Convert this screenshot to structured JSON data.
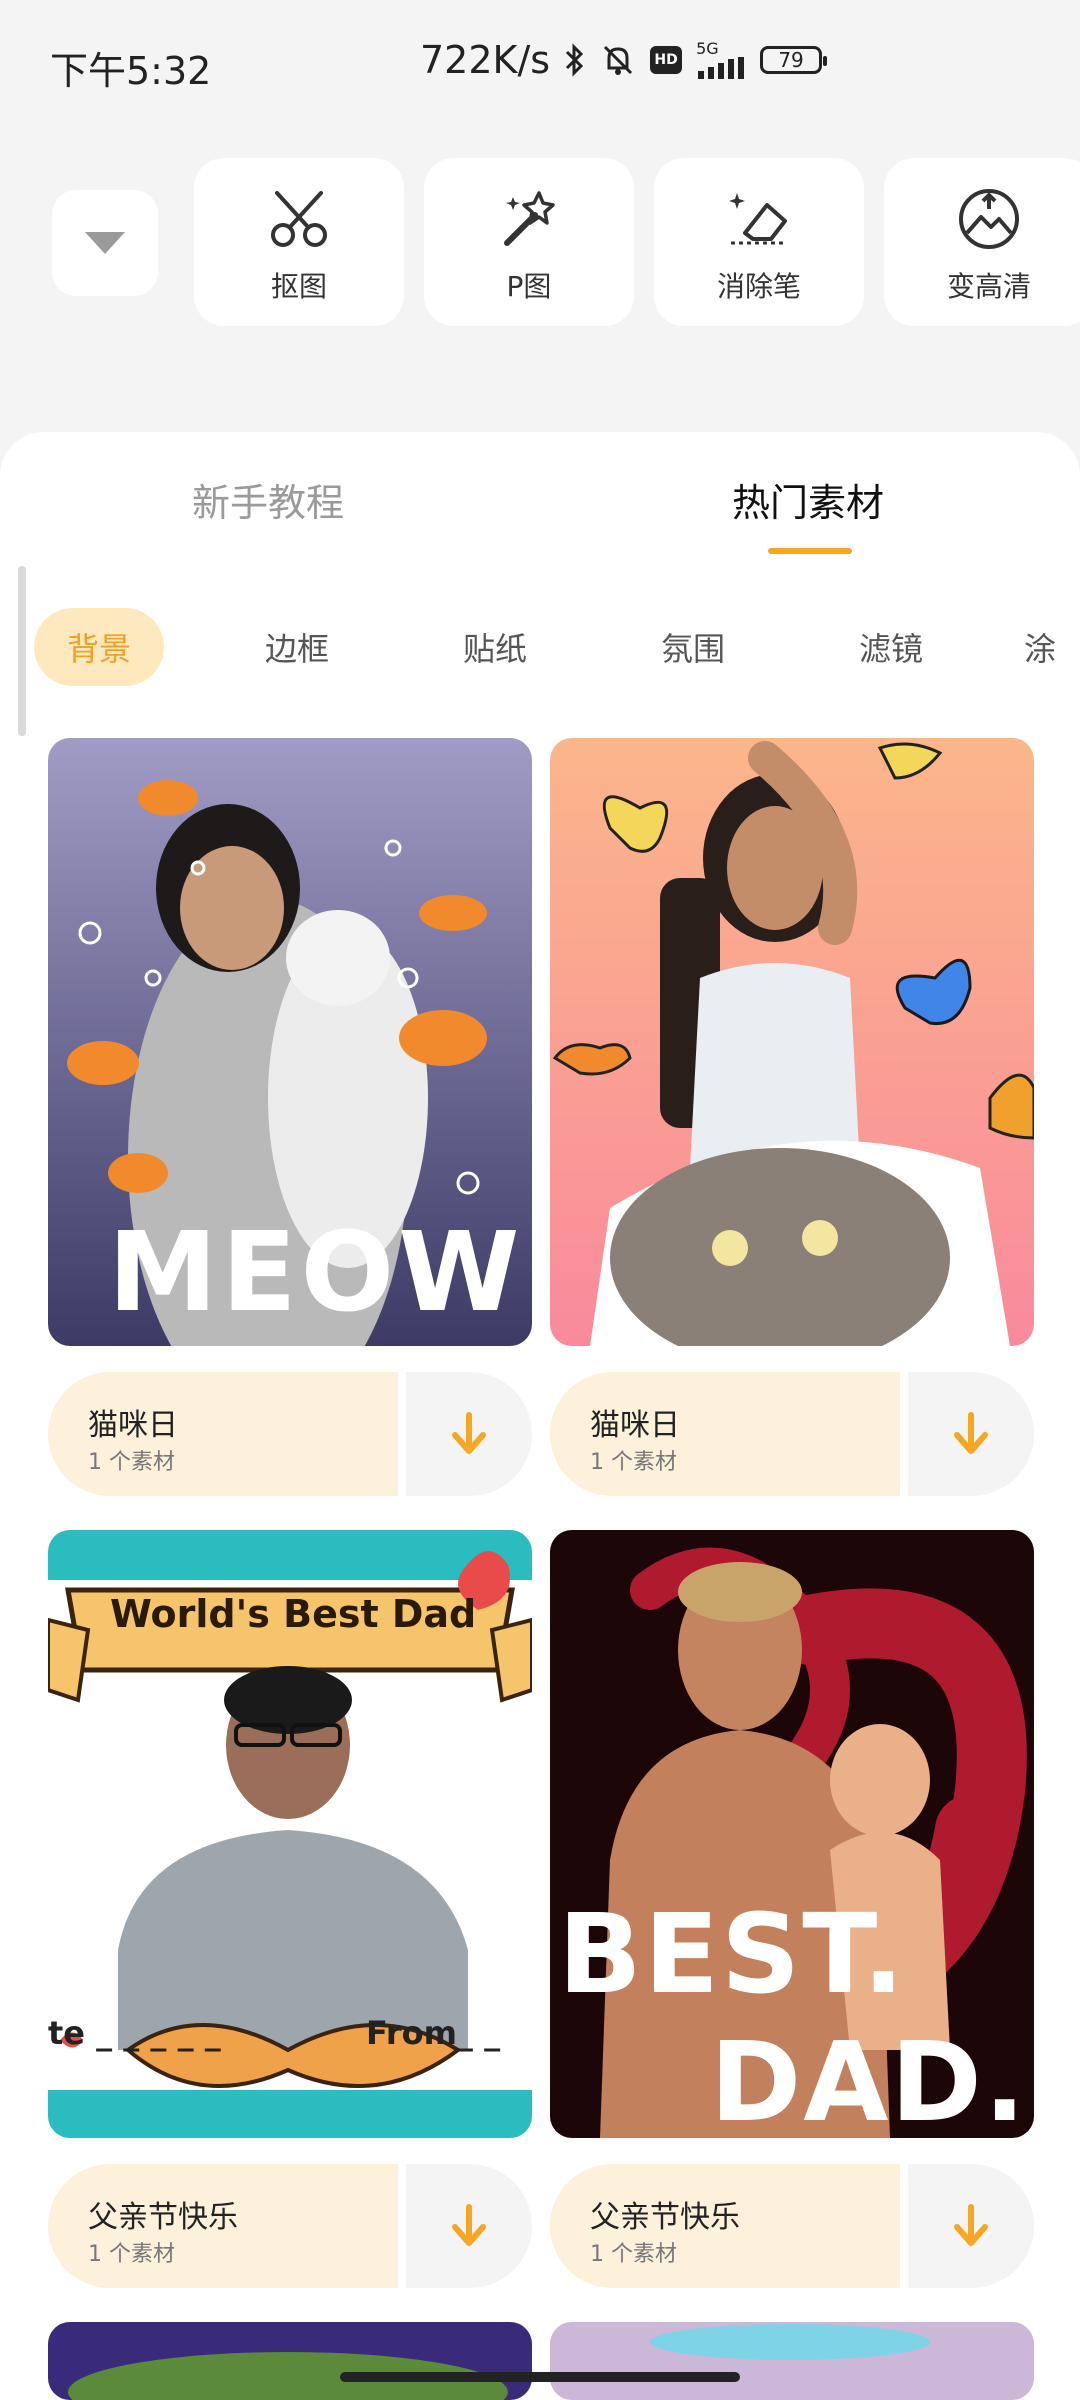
{
  "status_bar": {
    "time": "下午5:32",
    "speed": "722K/s",
    "network": "5G",
    "hd": "HD",
    "battery": "79"
  },
  "tools": [
    {
      "label": "抠图",
      "icon": "cutout-scissors-icon"
    },
    {
      "label": "P图",
      "icon": "magic-wand-icon"
    },
    {
      "label": "消除笔",
      "icon": "eraser-icon"
    },
    {
      "label": "变高清",
      "icon": "hd-enhance-icon"
    }
  ],
  "top_tabs": [
    {
      "label": "新手教程",
      "active": false
    },
    {
      "label": "热门素材",
      "active": true
    }
  ],
  "categories": [
    {
      "label": "背景",
      "active": true
    },
    {
      "label": "边框",
      "active": false
    },
    {
      "label": "贴纸",
      "active": false
    },
    {
      "label": "氛围",
      "active": false
    },
    {
      "label": "滤镜",
      "active": false
    },
    {
      "label": "涂",
      "active": false
    }
  ],
  "cards": [
    {
      "title": "猫咪日",
      "count": "1 个素材",
      "image_text": "MEOW"
    },
    {
      "title": "猫咪日",
      "count": "1 个素材",
      "image_text": ""
    },
    {
      "title": "父亲节快乐",
      "count": "1 个素材",
      "image_text": "World's Best Dad",
      "image_text2": "te _ _ _ _ _",
      "image_text3": "From_ _"
    },
    {
      "title": "父亲节快乐",
      "count": "1 个素材",
      "image_text": "BEST.",
      "image_text2": "DAD."
    }
  ],
  "colors": {
    "accent": "#f5a623",
    "card_info_bg": "#fdf1dc",
    "category_active_bg": "#fde9bd"
  }
}
